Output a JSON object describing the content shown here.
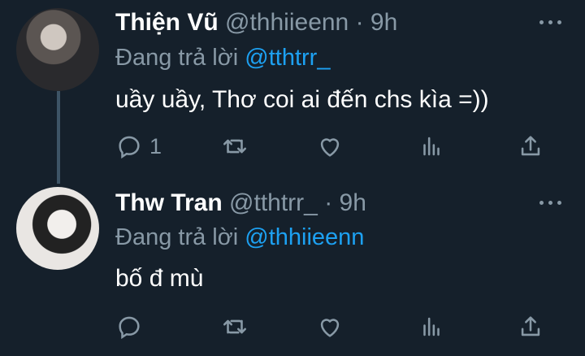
{
  "tweets": [
    {
      "name": "Thiện Vũ",
      "handle": "@thhiieenn",
      "time": "· 9h",
      "replying_prefix": "Đang trả lời",
      "replying_to": "@tthtrr_",
      "text": "uầy uầy, Thơ coi ai đến chs kìa =))",
      "reply_count": "1",
      "avatar_icon": "person-photo"
    },
    {
      "name": "Thw Tran",
      "handle": "@tthtrr_",
      "time": "· 9h",
      "replying_prefix": "Đang trả lời",
      "replying_to": "@thhiieenn",
      "text": "bố đ mù",
      "reply_count": "",
      "avatar_icon": "person-photo"
    }
  ],
  "icons": [
    "reply-icon",
    "retweet-icon",
    "like-icon",
    "analytics-icon",
    "share-icon",
    "more-icon"
  ],
  "colors": {
    "background": "#15202b",
    "accent": "#1da1f2",
    "muted": "#8899a6",
    "text": "#ffffff"
  }
}
